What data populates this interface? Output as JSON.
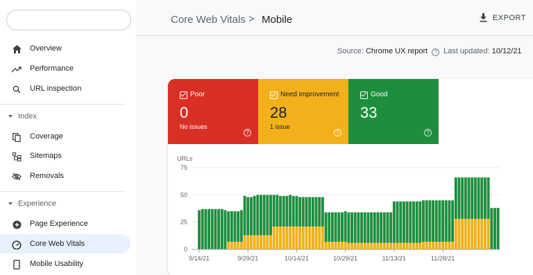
{
  "sidebar": {
    "search_placeholder": "",
    "items": [
      {
        "label": "Overview",
        "icon": "home-icon"
      },
      {
        "label": "Performance",
        "icon": "trending-up-icon"
      },
      {
        "label": "URL inspection",
        "icon": "search-icon"
      }
    ],
    "sections": [
      {
        "title": "Index",
        "items": [
          {
            "label": "Coverage",
            "icon": "coverage-icon"
          },
          {
            "label": "Sitemaps",
            "icon": "sitemap-icon"
          },
          {
            "label": "Removals",
            "icon": "eye-off-icon"
          }
        ]
      },
      {
        "title": "Experience",
        "items": [
          {
            "label": "Page Experience",
            "icon": "page-experience-icon"
          },
          {
            "label": "Core Web Vitals",
            "icon": "gauge-icon",
            "active": true
          },
          {
            "label": "Mobile Usability",
            "icon": "phone-icon"
          }
        ]
      }
    ]
  },
  "header": {
    "breadcrumb_root": "Core Web Vitals",
    "breadcrumb_separator": ">",
    "breadcrumb_current": "Mobile",
    "export_label": "EXPORT"
  },
  "meta": {
    "source_label": "Source:",
    "source_value": "Chrome UX report",
    "updated_label": "Last updated:",
    "updated_value": "10/12/21"
  },
  "tiles": [
    {
      "label": "Poor",
      "count": "0",
      "sub": "No issues",
      "color": "#d93025"
    },
    {
      "label": "Need improvement",
      "count": "28",
      "sub": "1 issue",
      "color": "#f2b11b"
    },
    {
      "label": "Good",
      "count": "33",
      "sub": "",
      "color": "#1e8e3e"
    }
  ],
  "chart_data": {
    "type": "bar",
    "stacked": true,
    "ylabel": "URLs",
    "ylim": [
      0,
      75
    ],
    "yticks": [
      "0",
      "25",
      "50",
      "75"
    ],
    "xtick_labels": [
      "9/14/21",
      "9/29/21",
      "10/14/21",
      "10/29/21",
      "11/13/21",
      "11/28/21"
    ],
    "xtick_index": [
      1,
      16,
      31,
      46,
      61,
      76
    ],
    "colors": {
      "Need improvement": "#f2b11b",
      "Good": "#1e8e3e"
    },
    "series": [
      {
        "name": "Need improvement",
        "values": [
          0,
          0,
          0,
          0,
          0,
          0,
          0,
          0,
          0,
          0,
          7,
          7,
          7,
          7,
          7,
          13,
          13,
          13,
          13,
          13,
          13,
          13,
          13,
          13,
          21,
          21,
          21,
          21,
          21,
          21,
          21,
          21,
          21,
          21,
          21,
          21,
          21,
          21,
          21,
          21,
          7,
          7,
          7,
          7,
          7,
          7,
          7,
          6,
          6,
          6,
          6,
          6,
          6,
          6,
          6,
          6,
          6,
          6,
          6,
          6,
          6,
          6,
          6,
          6,
          6,
          6,
          6,
          6,
          6,
          6,
          7,
          7,
          7,
          7,
          7,
          7,
          7,
          7,
          7,
          7,
          28,
          28,
          28,
          28,
          28,
          28,
          28,
          28,
          28,
          28,
          28
        ]
      },
      {
        "name": "Good",
        "values": [
          0,
          36,
          37,
          37,
          37,
          37,
          37,
          37,
          37,
          36,
          28,
          28,
          28,
          28,
          29,
          36,
          35,
          35,
          36,
          37,
          37,
          37,
          37,
          37,
          29,
          29,
          28,
          28,
          28,
          29,
          28,
          28,
          27,
          27,
          27,
          27,
          27,
          27,
          27,
          27,
          27,
          27,
          27,
          27,
          27,
          27,
          28,
          28,
          28,
          28,
          28,
          28,
          28,
          28,
          28,
          28,
          28,
          28,
          28,
          28,
          28,
          38,
          38,
          38,
          38,
          38,
          38,
          38,
          38,
          38,
          38,
          38,
          38,
          38,
          38,
          38,
          38,
          38,
          38,
          38,
          38,
          38,
          38,
          38,
          38,
          38,
          38,
          38,
          38,
          38,
          38,
          38,
          38,
          38
        ]
      }
    ]
  }
}
